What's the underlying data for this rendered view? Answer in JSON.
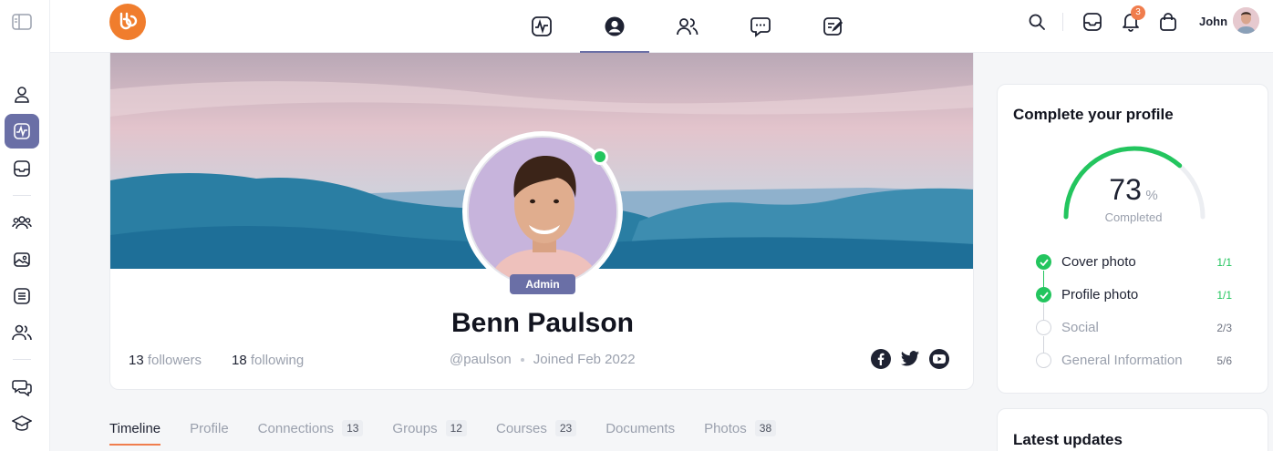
{
  "topbar": {
    "notifications_count": "3",
    "user_name": "John"
  },
  "profile": {
    "name": "Benn Paulson",
    "role_badge": "Admin",
    "followers_count": "13",
    "followers_label": "followers",
    "following_count": "18",
    "following_label": "following",
    "handle": "@paulson",
    "joined": "Joined Feb 2022"
  },
  "tabs": [
    {
      "label": "Timeline",
      "count": ""
    },
    {
      "label": "Profile",
      "count": ""
    },
    {
      "label": "Connections",
      "count": "13"
    },
    {
      "label": "Groups",
      "count": "12"
    },
    {
      "label": "Courses",
      "count": "23"
    },
    {
      "label": "Documents",
      "count": ""
    },
    {
      "label": "Photos",
      "count": "38"
    }
  ],
  "complete_profile": {
    "title": "Complete your profile",
    "percent": "73",
    "unit": "%",
    "completed_label": "Completed",
    "progress": 0.73,
    "steps": [
      {
        "label": "Cover photo",
        "fraction": "1/1",
        "done": true
      },
      {
        "label": "Profile photo",
        "fraction": "1/1",
        "done": true
      },
      {
        "label": "Social",
        "fraction": "2/3",
        "done": false
      },
      {
        "label": "General Information",
        "fraction": "5/6",
        "done": false
      }
    ]
  },
  "latest_updates": {
    "title": "Latest updates"
  },
  "colors": {
    "accent": "#6a6fa6",
    "brand": "#f07d2d",
    "success": "#23c55e",
    "tab_underline": "#f07d4d"
  }
}
